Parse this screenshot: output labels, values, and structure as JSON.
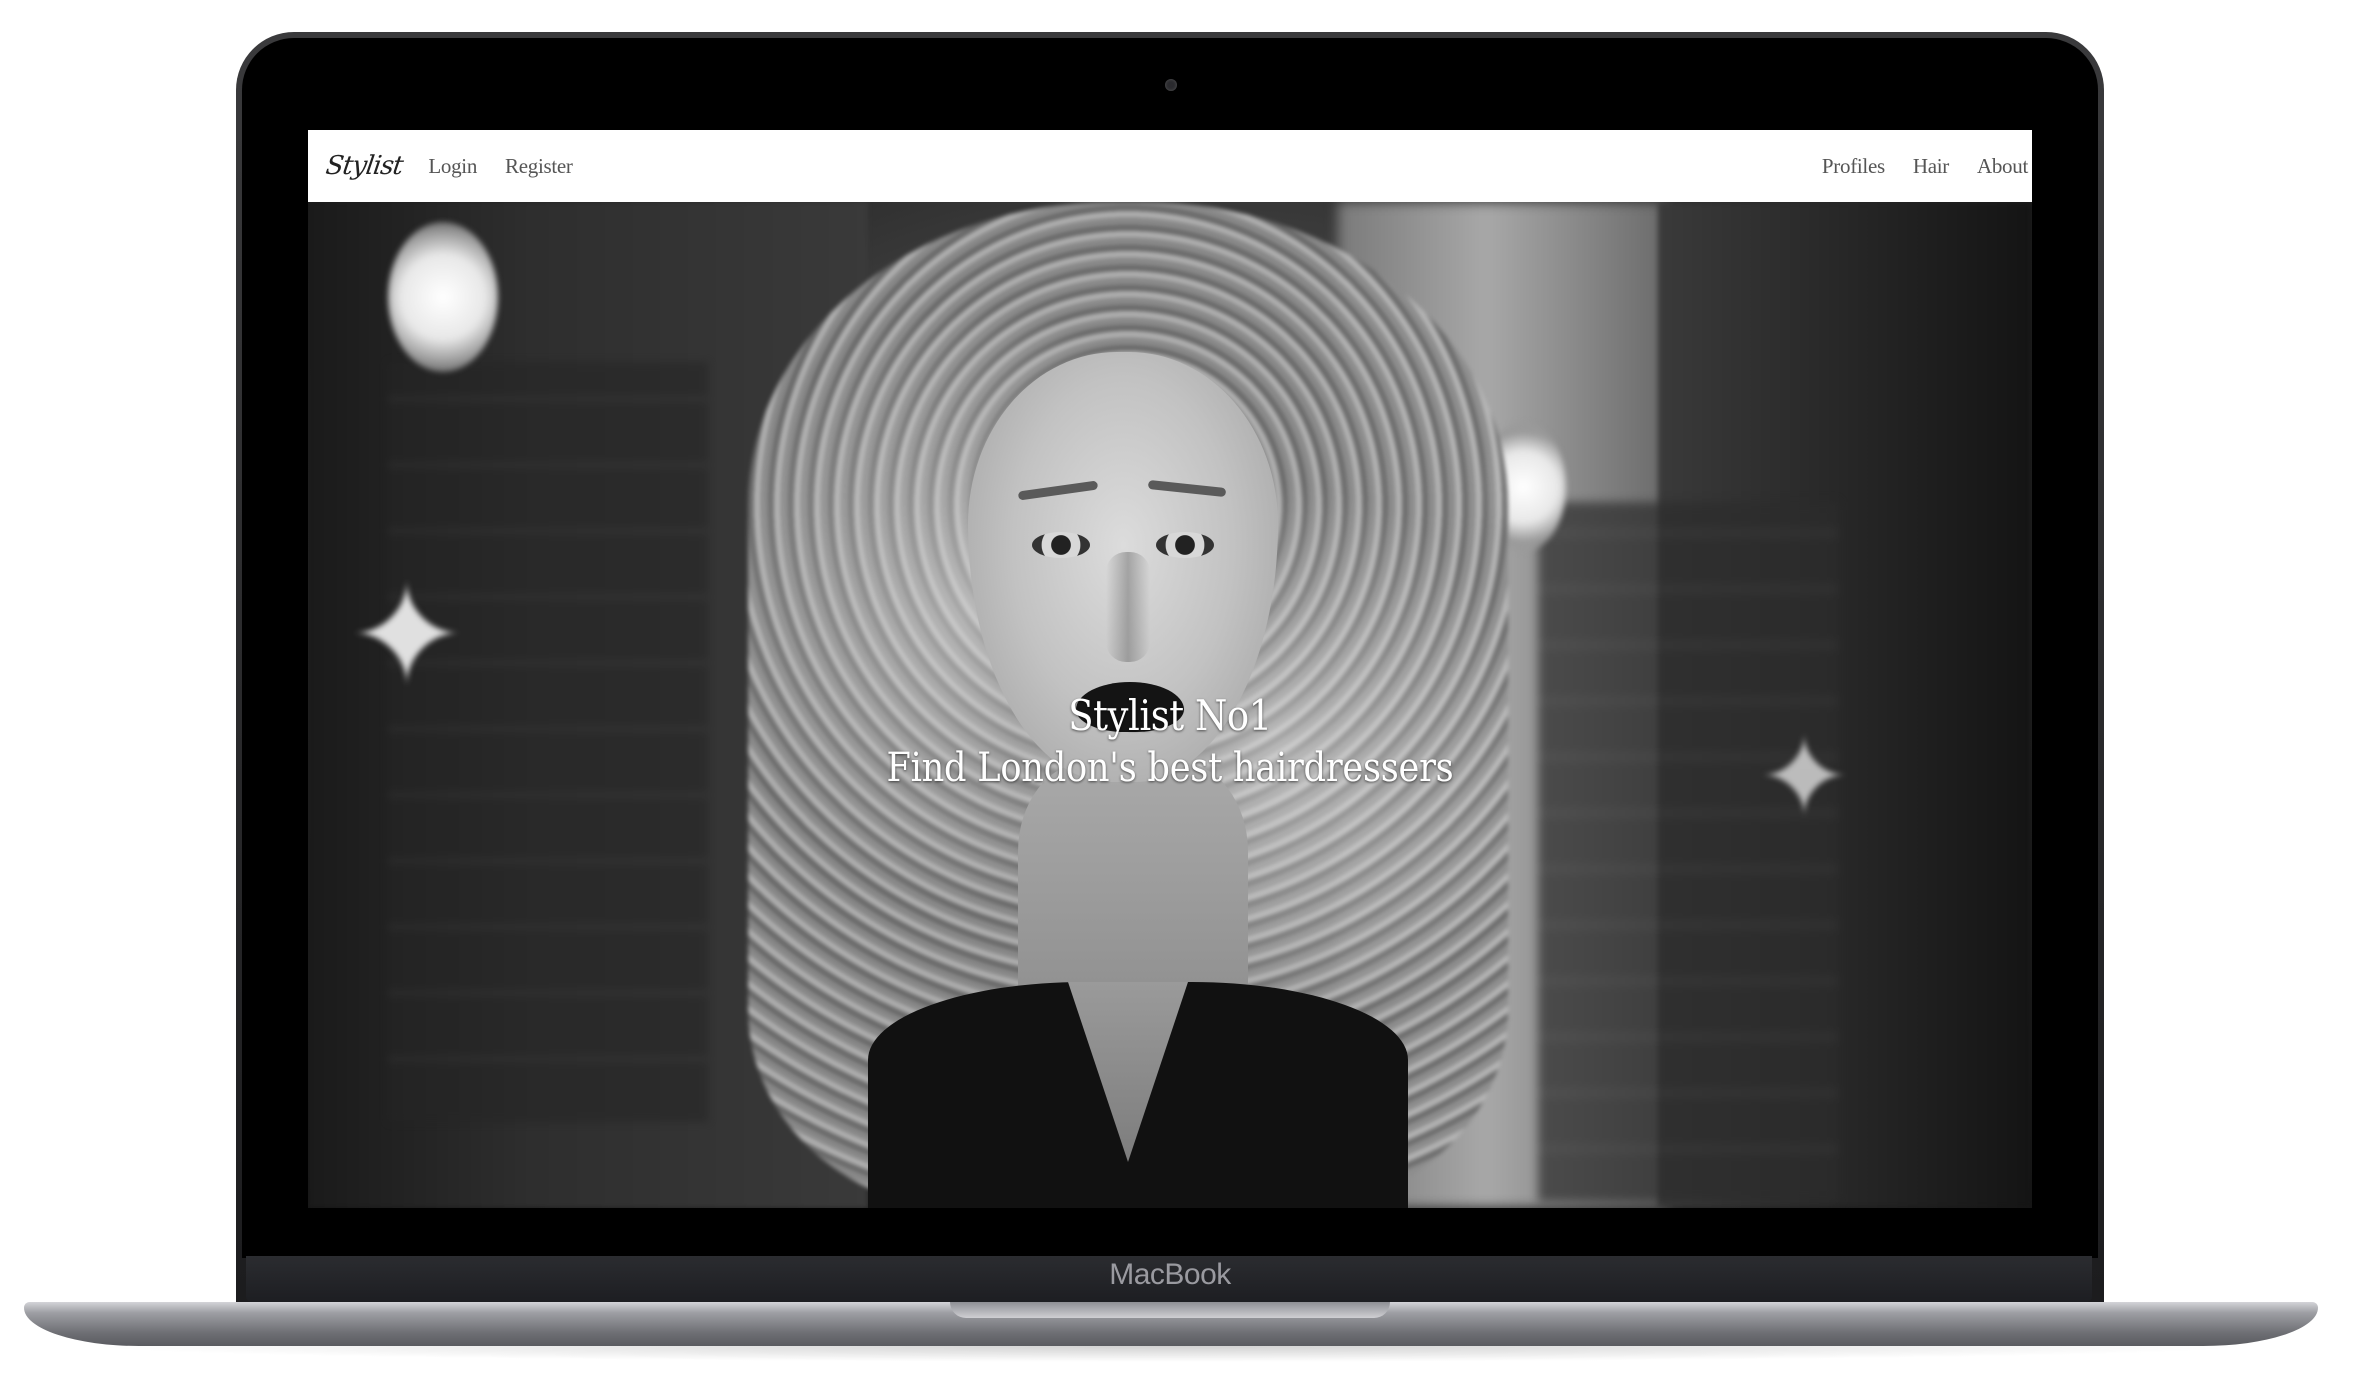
{
  "device": {
    "model_label": "MacBook"
  },
  "navbar": {
    "brand": "Stylist",
    "left_links": [
      {
        "label": "Login"
      },
      {
        "label": "Register"
      }
    ],
    "right_links": [
      {
        "label": "Profiles"
      },
      {
        "label": "Hair"
      },
      {
        "label": "About"
      }
    ]
  },
  "hero": {
    "title": "Stylist No1",
    "subtitle": "Find London's best hairdressers",
    "image": "black-and-white-portrait-photo"
  },
  "colors": {
    "navbar_bg": "#ffffff",
    "nav_text": "#555555",
    "hero_text": "#ffffff",
    "bezel": "#000000"
  }
}
